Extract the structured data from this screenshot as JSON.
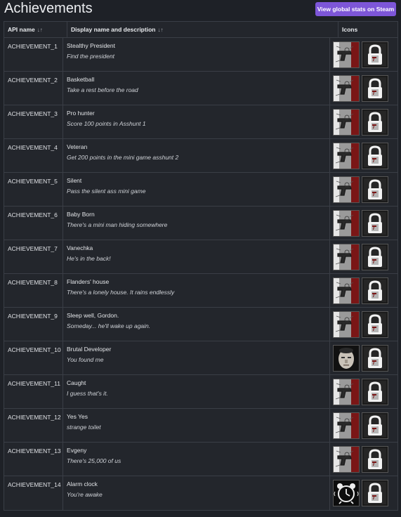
{
  "header": {
    "title": "Achievements",
    "global_button": "View global stats on Steam"
  },
  "table": {
    "columns": {
      "api": "API name",
      "name": "Display name and description",
      "icons": "Icons"
    },
    "rows": [
      {
        "api": "ACHIEVEMENT_1",
        "name": "Stealthy President",
        "desc": "Find the president",
        "icon": "pistol-icon"
      },
      {
        "api": "ACHIEVEMENT_2",
        "name": "Basketball",
        "desc": "Take a rest before the road",
        "icon": "pistol-icon"
      },
      {
        "api": "ACHIEVEMENT_3",
        "name": "Pro hunter",
        "desc": "Score 100 points in Asshunt 1",
        "icon": "pistol-icon"
      },
      {
        "api": "ACHIEVEMENT_4",
        "name": "Veteran",
        "desc": "Get 200 points in the mini game asshunt 2",
        "icon": "pistol-icon"
      },
      {
        "api": "ACHIEVEMENT_5",
        "name": "Silent",
        "desc": "Pass the silent ass mini game",
        "icon": "pistol-icon"
      },
      {
        "api": "ACHIEVEMENT_6",
        "name": "Baby Born",
        "desc": "There's a mini man hiding somewhere",
        "icon": "pistol-icon"
      },
      {
        "api": "ACHIEVEMENT_7",
        "name": "Vanechka",
        "desc": "He's in the back!",
        "icon": "pistol-icon"
      },
      {
        "api": "ACHIEVEMENT_8",
        "name": "Flanders' house",
        "desc": "There's a lonely house. It rains endlessly",
        "icon": "pistol-icon"
      },
      {
        "api": "ACHIEVEMENT_9",
        "name": "Sleep well, Gordon.",
        "desc": "Someday... he'll wake up again.",
        "icon": "pistol-icon"
      },
      {
        "api": "ACHIEVEMENT_10",
        "name": "Brutal Developer",
        "desc": "You found me",
        "icon": "face-icon"
      },
      {
        "api": "ACHIEVEMENT_11",
        "name": "Caught",
        "desc": "I guess that's it.",
        "icon": "pistol-icon"
      },
      {
        "api": "ACHIEVEMENT_12",
        "name": "Yes Yes",
        "desc": "strange toilet",
        "icon": "pistol-icon"
      },
      {
        "api": "ACHIEVEMENT_13",
        "name": "Evgeny",
        "desc": "There's 25,000 of us",
        "icon": "pistol-icon"
      },
      {
        "api": "ACHIEVEMENT_14",
        "name": "Alarm clock",
        "desc": "You're awake",
        "icon": "alarm-clock-icon"
      }
    ]
  },
  "colors": {
    "background": "#1e2127",
    "button": "#7d56d8",
    "accent_red": "#8a1c1c"
  }
}
